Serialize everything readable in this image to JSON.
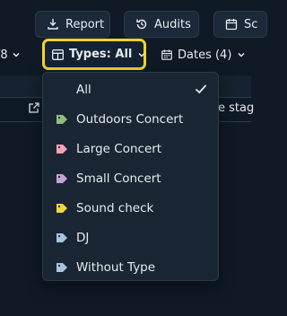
{
  "toolbar": {
    "report_label": "Report",
    "audits_label": "Audits",
    "third_label": "Sc"
  },
  "filters": {
    "pager_label": "/8",
    "types_label": "Types: All",
    "dates_label": "Dates (4)"
  },
  "table": {
    "partial_header_text": "e stag"
  },
  "types_menu": {
    "items": [
      {
        "label": "All",
        "selected": true
      },
      {
        "label": "Outdoors Concert",
        "color": "#8fbf7a"
      },
      {
        "label": "Large Concert",
        "color": "#f2a3b3"
      },
      {
        "label": "Small Concert",
        "color": "#c5a2d6"
      },
      {
        "label": "Sound check",
        "color": "#f0d53a"
      },
      {
        "label": "DJ",
        "color": "#a8c4dc"
      },
      {
        "label": "Without Type",
        "color": "#a8c4dc"
      }
    ]
  }
}
